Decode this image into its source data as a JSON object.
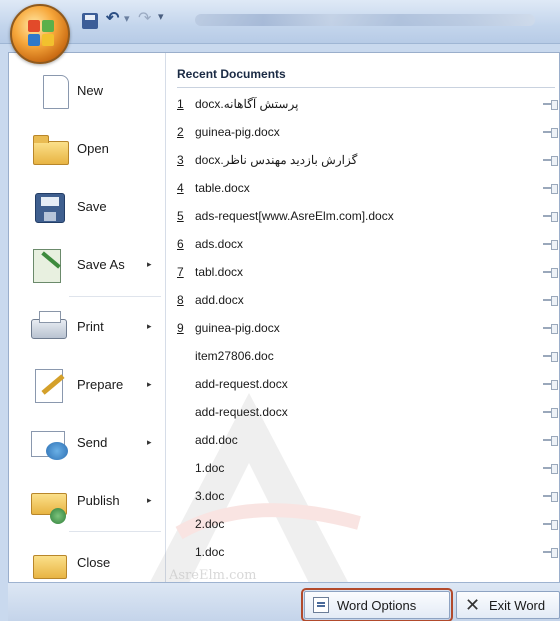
{
  "quick_access": {
    "save_icon": "save-icon",
    "undo_icon": "undo-icon",
    "redo_icon": "redo-icon",
    "customize_icon": "dropdown-icon"
  },
  "menu": {
    "commands": [
      {
        "label": "New",
        "icon": "new-document-icon",
        "has_submenu": false
      },
      {
        "label": "Open",
        "icon": "open-folder-icon",
        "has_submenu": false
      },
      {
        "label": "Save",
        "icon": "floppy-save-icon",
        "has_submenu": false
      },
      {
        "label": "Save As",
        "icon": "save-as-icon",
        "has_submenu": true
      },
      {
        "label": "Print",
        "icon": "printer-icon",
        "has_submenu": true
      },
      {
        "label": "Prepare",
        "icon": "prepare-icon",
        "has_submenu": true
      },
      {
        "label": "Send",
        "icon": "send-icon",
        "has_submenu": true
      },
      {
        "label": "Publish",
        "icon": "publish-icon",
        "has_submenu": true
      },
      {
        "label": "Close",
        "icon": "close-folder-icon",
        "has_submenu": false
      }
    ],
    "submenu_arrow": "▸"
  },
  "recent": {
    "title": "Recent Documents",
    "items": [
      {
        "num": "1",
        "name": "پرستش آگاهانه.docx"
      },
      {
        "num": "2",
        "name": "guinea-pig.docx"
      },
      {
        "num": "3",
        "name": "گزارش بازدید مهندس ناظر.docx"
      },
      {
        "num": "4",
        "name": "table.docx"
      },
      {
        "num": "5",
        "name": "ads-request[www.AsreElm.com].docx"
      },
      {
        "num": "6",
        "name": "ads.docx"
      },
      {
        "num": "7",
        "name": "tabl.docx"
      },
      {
        "num": "8",
        "name": "add.docx"
      },
      {
        "num": "9",
        "name": "guinea-pig.docx"
      },
      {
        "num": "",
        "name": "item27806.doc"
      },
      {
        "num": "",
        "name": "add-request.docx"
      },
      {
        "num": "",
        "name": "add-request.docx"
      },
      {
        "num": "",
        "name": "add.doc"
      },
      {
        "num": "",
        "name": "1.doc"
      },
      {
        "num": "",
        "name": "3.doc"
      },
      {
        "num": "",
        "name": "2.doc"
      },
      {
        "num": "",
        "name": "1.doc"
      }
    ]
  },
  "watermark": {
    "text": "AsreElm.com"
  },
  "footer": {
    "word_options": "Word Options",
    "exit_word": "Exit Word"
  },
  "colors": {
    "highlight_border": "#b24a2c",
    "accent_blue": "#c4d4ea"
  }
}
